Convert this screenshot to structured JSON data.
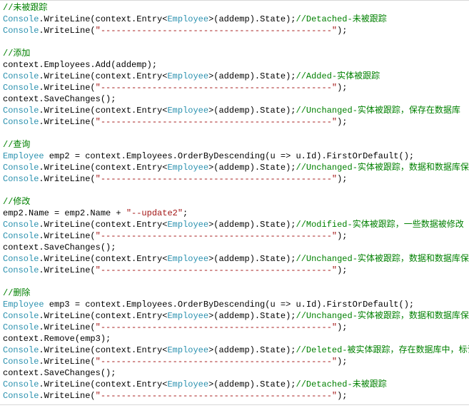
{
  "source": {
    "language": "C#",
    "color_scheme": "Visual Studio Light"
  },
  "tokens": {
    "Console": "Console",
    "WriteLine": ".WriteLine(",
    "ctxEntry": "context.Entry<",
    "Employee": "Employee",
    "addempClose": ">(addemp).State);",
    "dashes": "\"---------------------------------------------\"",
    "dashesClose": ");",
    "addStmt": "context.Employees.Add(addemp);",
    "save": "context.SaveChanges();",
    "sp": " ",
    "emp2decl_a": " emp2 = context.Employees.OrderByDescending(u => u.Id).FirstOrDefault();",
    "emp3decl_a": " emp3 = context.Employees.OrderByDescending(u => u.Id).FirstOrDefault();",
    "emp2assign_a": "emp2.Name = emp2.Name + ",
    "emp2assign_b": "\"--update2\"",
    "emp2assign_c": ";",
    "remove": "context.Remove(emp3);"
  },
  "comments": {
    "top": "//未被跟踪",
    "detached": "//Detached-未被跟踪",
    "add_header": "//添加",
    "added": "//Added-实体被跟踪",
    "unchanged_saved": "//Unchanged-实体被跟踪，保存在数据库",
    "query_header": "//查询",
    "unchanged_sync": "//Unchanged-实体被跟踪，数据和数据库保持一致",
    "modify_header": "//修改",
    "modified": "//Modified-实体被跟踪，一些数据被修改",
    "delete_header": "//删除",
    "deleted": "//Deleted-被实体跟踪，存在数据库中，标记为要删除了"
  }
}
